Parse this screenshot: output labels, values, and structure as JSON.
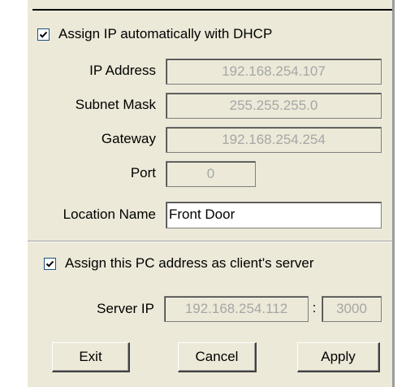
{
  "dhcp": {
    "label": "Assign IP automatically with  DHCP",
    "checked": true
  },
  "fields": {
    "ip_address": {
      "label": "IP Address",
      "value": "192.168.254.107"
    },
    "subnet_mask": {
      "label": "Subnet Mask",
      "value": "255.255.255.0"
    },
    "gateway": {
      "label": "Gateway",
      "value": "192.168.254.254"
    },
    "port": {
      "label": "Port",
      "value": "0"
    },
    "location_name": {
      "label": "Location Name",
      "value": "Front Door"
    }
  },
  "client_server": {
    "label": "Assign this PC address as client's server",
    "checked": true
  },
  "server": {
    "label": "Server IP",
    "ip": "192.168.254.112",
    "separator": ":",
    "port": "3000"
  },
  "buttons": {
    "exit": "Exit",
    "cancel": "Cancel",
    "apply": "Apply"
  },
  "colors": {
    "panel_bg": "#ece9d8",
    "disabled_text": "#a6a6a6",
    "checkbox_border": "#1c5180"
  }
}
